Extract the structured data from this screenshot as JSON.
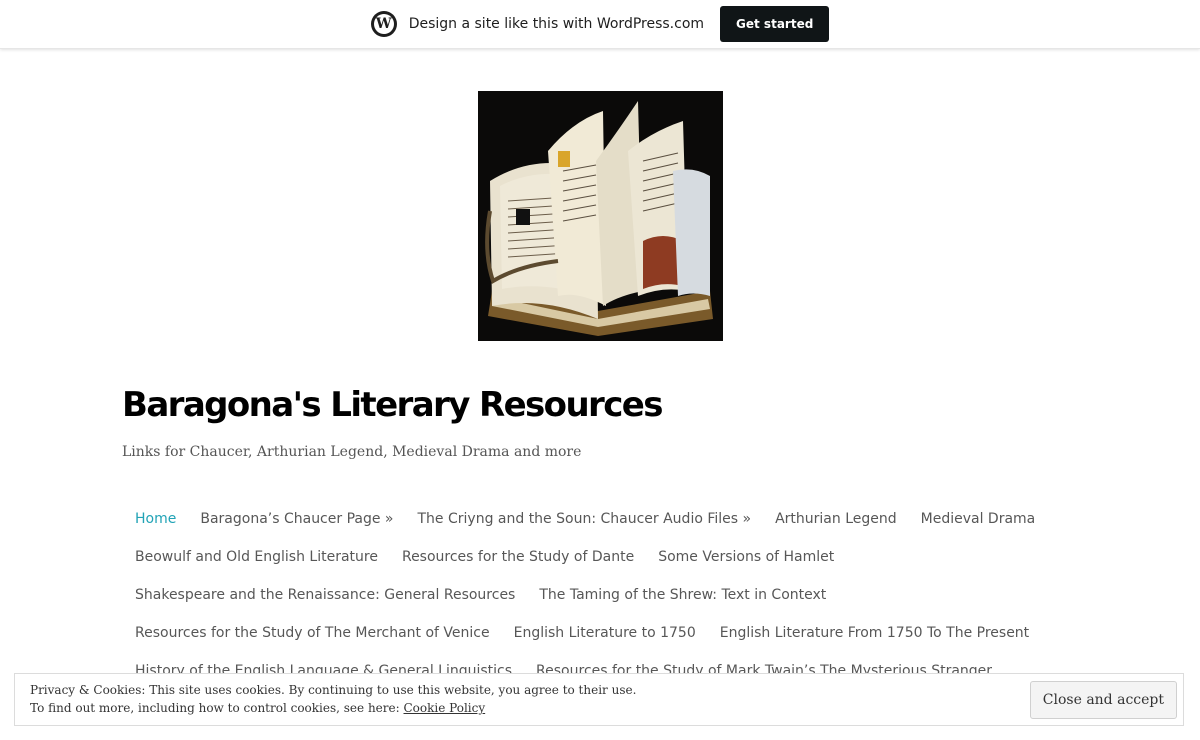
{
  "wpbar": {
    "icon": "wordpress-icon",
    "text": "Design a site like this with WordPress.com",
    "button": "Get started"
  },
  "site": {
    "header_image": "open-book-image",
    "title": "Baragona's Literary Resources",
    "tagline": "Links for Chaucer, Arthurian Legend, Medieval Drama and more"
  },
  "nav": {
    "rows": [
      [
        "Home",
        "Baragona’s Chaucer Page »",
        "The Criyng and the Soun: Chaucer Audio Files »",
        "Arthurian Legend",
        "Medieval Drama"
      ],
      [
        "Beowulf and Old English Literature",
        "Resources for the Study of Dante",
        "Some Versions of Hamlet"
      ],
      [
        "Shakespeare and the Renaissance: General Resources",
        "The Taming of the Shrew: Text in Context"
      ],
      [
        "Resources for the Study of The Merchant of Venice",
        "English Literature to 1750",
        "English Literature From 1750 To The Present"
      ],
      [
        "History of the English Language & General Linguistics",
        "Resources for the Study of Mark Twain’s The Mysterious Stranger"
      ]
    ],
    "current_color": "#21a3b6",
    "link_color": "#575757"
  },
  "cookie": {
    "line1": "Privacy & Cookies: This site uses cookies. By continuing to use this website, you agree to their use.",
    "line2_prefix": "To find out more, including how to control cookies, see here:",
    "link": "Cookie Policy",
    "button": "Close and accept"
  }
}
